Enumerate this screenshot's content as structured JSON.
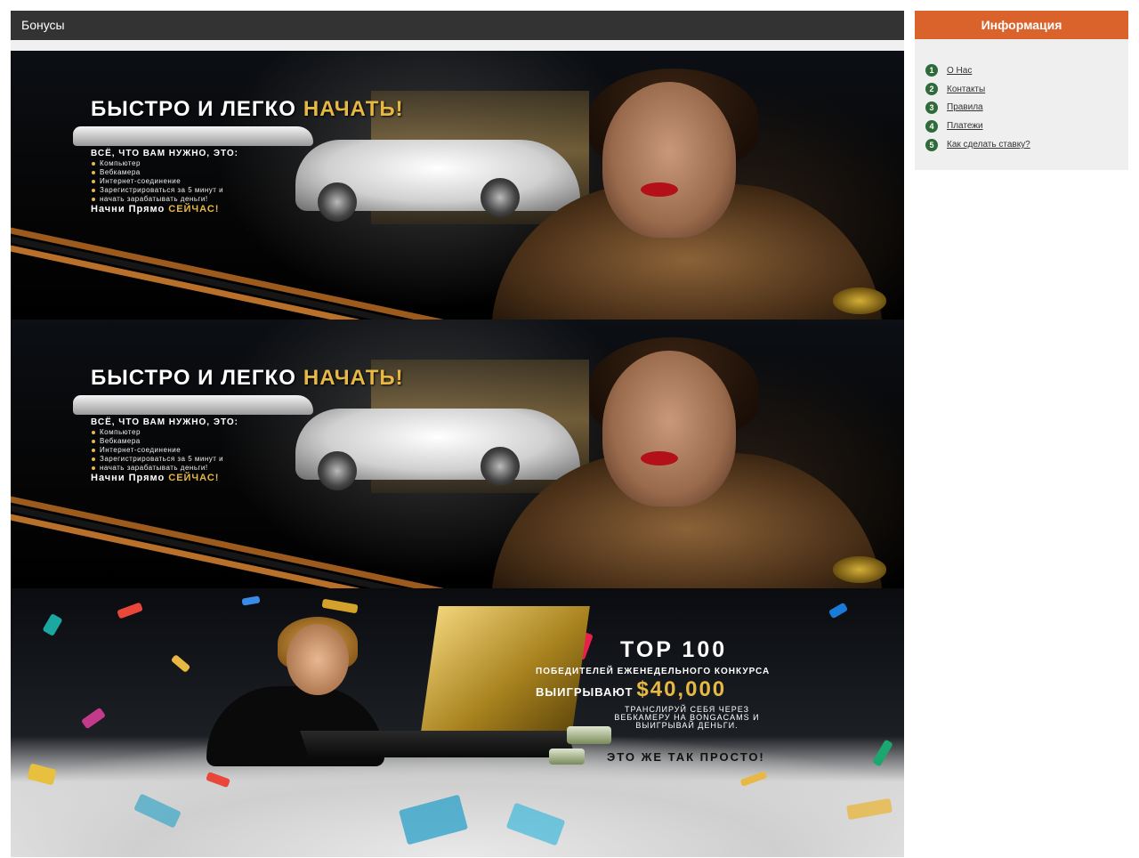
{
  "main": {
    "title": "Бонусы"
  },
  "banners": [
    {
      "headline_white": "БЫСТРО И ЛЕГКО",
      "headline_gold": "НАЧАТЬ!",
      "need_title": "ВСЁ, ЧТО ВАМ НУЖНО, ЭТО:",
      "list": [
        "Компьютер",
        "Вебкамера",
        "Интернет-соединение",
        "Зарегистрироваться за 5 минут и",
        "начать зарабатывать деньги!"
      ],
      "cta_white": "Начни Прямо",
      "cta_gold": "СЕЙЧАС!"
    },
    {
      "headline_white": "БЫСТРО И ЛЕГКО",
      "headline_gold": "НАЧАТЬ!",
      "need_title": "ВСЁ, ЧТО ВАМ НУЖНО, ЭТО:",
      "list": [
        "Компьютер",
        "Вебкамера",
        "Интернет-соединение",
        "Зарегистрироваться за 5 минут и",
        "начать зарабатывать деньги!"
      ],
      "cta_white": "Начни Прямо",
      "cta_gold": "СЕЙЧАС!"
    },
    {
      "top_title": "TOP 100",
      "winners_line": "ПОБЕДИТЕЛЕЙ ЕЖЕНЕДЕЛЬНОГО КОНКУРСА",
      "win_word": "ВЫИГРЫВАЮТ",
      "amount": "$40,000",
      "stream_line1": "ТРАНСЛИРУЙ СЕБЯ ЧЕРЕЗ",
      "stream_line2": "ВЕБКАМЕРУ НА BONGACAMS И",
      "stream_line3": "ВЫИГРЫВАЙ ДЕНЬГИ.",
      "easy": "ЭТО ЖЕ ТАК ПРОСТО!"
    }
  ],
  "sidebar": {
    "title": "Информация",
    "items": [
      {
        "num": "1",
        "label": "О Нас"
      },
      {
        "num": "2",
        "label": "Контакты"
      },
      {
        "num": "3",
        "label": "Правила"
      },
      {
        "num": "4",
        "label": "Платежи"
      },
      {
        "num": "5",
        "label": "Как сделать ставку?"
      }
    ]
  },
  "colors": {
    "header_bg": "#333333",
    "sidebar_header_bg": "#d9632b",
    "number_badge": "#2f6b3a",
    "gold": "#e7b843"
  }
}
